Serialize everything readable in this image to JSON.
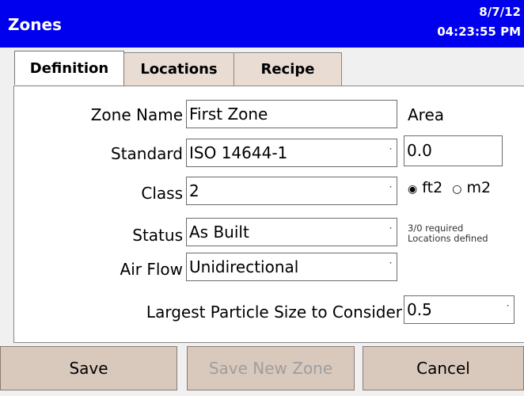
{
  "app": {
    "title": "Zones",
    "date": "8/7/12",
    "time": "04:23:55 PM"
  },
  "tabs": [
    {
      "label": "Definition",
      "active": true
    },
    {
      "label": "Locations",
      "active": false
    },
    {
      "label": "Recipe",
      "active": false
    }
  ],
  "form": {
    "zone_name": {
      "label": "Zone Name",
      "value": "First Zone"
    },
    "standard": {
      "label": "Standard",
      "value": "ISO 14644-1"
    },
    "class": {
      "label": "Class",
      "value": "2"
    },
    "status": {
      "label": "Status",
      "value": "As Built"
    },
    "air_flow": {
      "label": "Air Flow",
      "value": "Unidirectional"
    },
    "largest_particle": {
      "label": "Largest Particle Size to Consider",
      "value": "0.5"
    }
  },
  "area": {
    "label": "Area",
    "value": "0.0",
    "units": [
      {
        "label": "ft2",
        "selected": true
      },
      {
        "label": "m2",
        "selected": false
      }
    ]
  },
  "locations_note": {
    "line1": "3/0 required",
    "line2": "Locations defined"
  },
  "buttons": {
    "save": "Save",
    "save_new": "Save New Zone",
    "cancel": "Cancel"
  },
  "icons": {
    "dropdown_arrow": "dropdown-arrow-icon",
    "radio_selected": "radio-selected-icon",
    "radio_unselected": "radio-unselected-icon"
  },
  "colors": {
    "titlebar": "#0000ee",
    "button_bg": "#d9c8bc",
    "tab_bg": "#e8dcd3"
  }
}
